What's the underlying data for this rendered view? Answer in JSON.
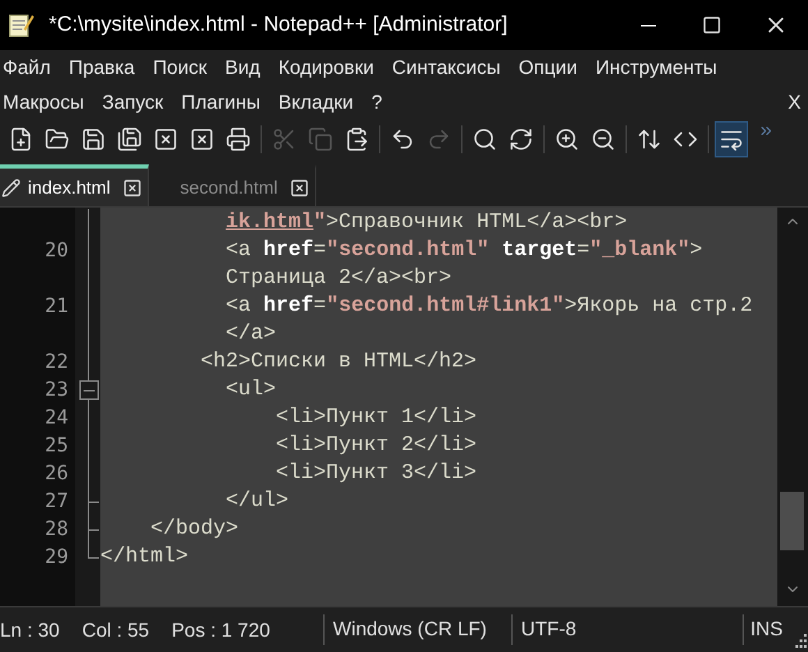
{
  "window": {
    "title": "*C:\\mysite\\index.html - Notepad++ [Administrator]"
  },
  "menu": {
    "items": [
      "Файл",
      "Правка",
      "Поиск",
      "Вид",
      "Кодировки",
      "Синтаксисы",
      "Опции",
      "Инструменты",
      "Макросы",
      "Запуск",
      "Плагины",
      "Вкладки",
      "?"
    ],
    "close_label": "X"
  },
  "toolbar": [
    {
      "kind": "new",
      "disabled": false,
      "selected": false
    },
    {
      "kind": "open",
      "disabled": false,
      "selected": false
    },
    {
      "kind": "save",
      "disabled": false,
      "selected": false
    },
    {
      "kind": "save-all",
      "disabled": false,
      "selected": false
    },
    {
      "kind": "close",
      "disabled": false,
      "selected": false
    },
    {
      "kind": "close-all",
      "disabled": false,
      "selected": false
    },
    {
      "kind": "print",
      "disabled": false,
      "selected": false
    },
    {
      "kind": "cut",
      "disabled": true,
      "selected": false
    },
    {
      "kind": "copy",
      "disabled": true,
      "selected": false
    },
    {
      "kind": "paste",
      "disabled": false,
      "selected": false
    },
    {
      "kind": "undo",
      "disabled": false,
      "selected": false
    },
    {
      "kind": "redo",
      "disabled": true,
      "selected": false
    },
    {
      "kind": "find",
      "disabled": false,
      "selected": false
    },
    {
      "kind": "replace",
      "disabled": false,
      "selected": false
    },
    {
      "kind": "zoom-in",
      "disabled": false,
      "selected": false
    },
    {
      "kind": "zoom-out",
      "disabled": false,
      "selected": false
    },
    {
      "kind": "sync-v",
      "disabled": false,
      "selected": false
    },
    {
      "kind": "sync-h",
      "disabled": false,
      "selected": false
    },
    {
      "kind": "wrap",
      "disabled": false,
      "selected": true
    }
  ],
  "tabs": [
    {
      "label": "index.html",
      "selected": true,
      "modified": true
    },
    {
      "label": "second.html",
      "selected": false,
      "modified": false
    }
  ],
  "editor": {
    "lines": [
      {
        "fold_start": false,
        "fold_end": false,
        "tokens": [
          {
            "kind": "link",
            "text": "          ik.html"
          },
          {
            "kind": "string",
            "text": "\""
          },
          {
            "kind": "text",
            "text": ">Справочник HTML</a><br>"
          }
        ]
      },
      {
        "number": "20",
        "fold_start": false,
        "fold_end": false,
        "tokens": [
          {
            "kind": "text",
            "text": "          <a "
          },
          {
            "kind": "attr",
            "text": "href"
          },
          {
            "kind": "text",
            "text": "="
          },
          {
            "kind": "string",
            "text": "\"second.html\" "
          },
          {
            "kind": "attr",
            "text": "target"
          },
          {
            "kind": "text",
            "text": "="
          },
          {
            "kind": "string",
            "text": "\"_blank\""
          },
          {
            "kind": "text",
            "text": ">"
          }
        ]
      },
      {
        "fold_start": false,
        "fold_end": false,
        "tokens": [
          {
            "kind": "text",
            "text": "          Страница 2</a><br>"
          }
        ]
      },
      {
        "number": "21",
        "fold_start": false,
        "fold_end": false,
        "tokens": [
          {
            "kind": "text",
            "text": "          <a "
          },
          {
            "kind": "attr",
            "text": "href"
          },
          {
            "kind": "text",
            "text": "="
          },
          {
            "kind": "string",
            "text": "\"second.html#link1\""
          },
          {
            "kind": "text",
            "text": ">Якорь на стр.2"
          }
        ]
      },
      {
        "fold_start": false,
        "fold_end": false,
        "tokens": [
          {
            "kind": "text",
            "text": "          </a>"
          }
        ]
      },
      {
        "number": "22",
        "fold_start": false,
        "fold_end": false,
        "tokens": [
          {
            "kind": "text",
            "text": "        <h2>Списки в HTML</h2>"
          }
        ]
      },
      {
        "number": "23",
        "fold_start": true,
        "fold_end": false,
        "tokens": [
          {
            "kind": "text",
            "text": "          <ul>"
          }
        ]
      },
      {
        "number": "24",
        "fold_start": false,
        "fold_end": false,
        "tokens": [
          {
            "kind": "text",
            "text": "              <li>Пункт 1</li>"
          }
        ]
      },
      {
        "number": "25",
        "fold_start": false,
        "fold_end": false,
        "tokens": [
          {
            "kind": "text",
            "text": "              <li>Пункт 2</li>"
          }
        ]
      },
      {
        "number": "26",
        "fold_start": false,
        "fold_end": false,
        "tokens": [
          {
            "kind": "text",
            "text": "              <li>Пункт 3</li>"
          }
        ]
      },
      {
        "number": "27",
        "fold_start": false,
        "fold_end": true,
        "tokens": [
          {
            "kind": "text",
            "text": "          </ul>"
          }
        ]
      },
      {
        "number": "28",
        "fold_start": false,
        "fold_end": true,
        "tokens": [
          {
            "kind": "text",
            "text": "    </body>"
          }
        ]
      },
      {
        "number": "29",
        "fold_start": false,
        "fold_end": true,
        "tokens": [
          {
            "kind": "text",
            "text": "</html>"
          }
        ]
      }
    ]
  },
  "status_bar": {
    "left": [
      "Ln : 30",
      "Col : 55",
      "Pos : 1 720"
    ],
    "eol": "Windows (CR LF)",
    "encoding": "UTF-8",
    "mode": "INS"
  }
}
